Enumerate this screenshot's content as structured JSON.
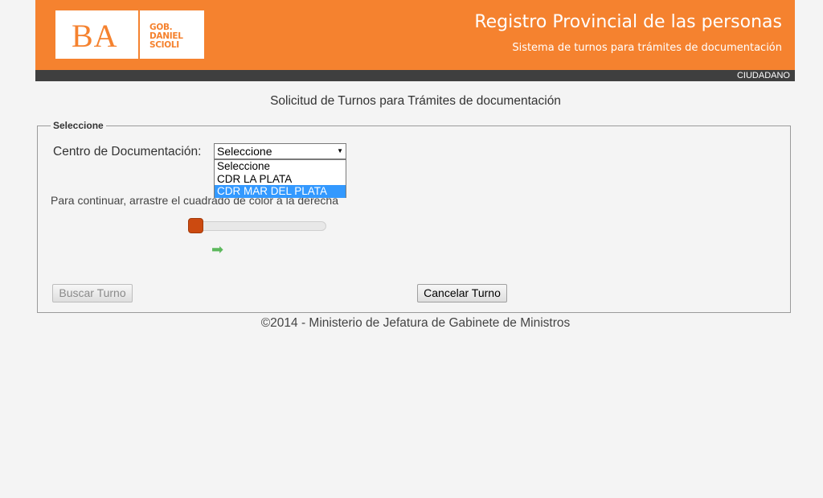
{
  "header": {
    "logo_ba": "BA",
    "logo_lines": [
      "GOB.",
      "DANIEL",
      "SCIOLI"
    ],
    "title": "Registro Provincial de las personas",
    "subtitle": "Sistema de turnos para trámites de documentación",
    "role": "CIUDADANO",
    "brand_color": "#f5822f"
  },
  "page": {
    "heading": "Solicitud de Turnos para Trámites de documentación"
  },
  "form": {
    "legend": "Seleccione",
    "centro_label": "Centro de Documentación:",
    "select_value": "Seleccione",
    "options": [
      "Seleccione",
      "CDR LA PLATA",
      "CDR MAR DEL PLATA"
    ],
    "highlighted_option": "CDR MAR DEL PLATA",
    "instruction": "Para continuar, arrastre el cuadrado de color a la derecha",
    "slider_progress": 0,
    "arrow_icon": "right-arrow-icon",
    "buscar_label": "Buscar Turno",
    "cancelar_label": "Cancelar Turno"
  },
  "footer": {
    "text": "©2014 - Ministerio de Jefatura de Gabinete de Ministros"
  }
}
